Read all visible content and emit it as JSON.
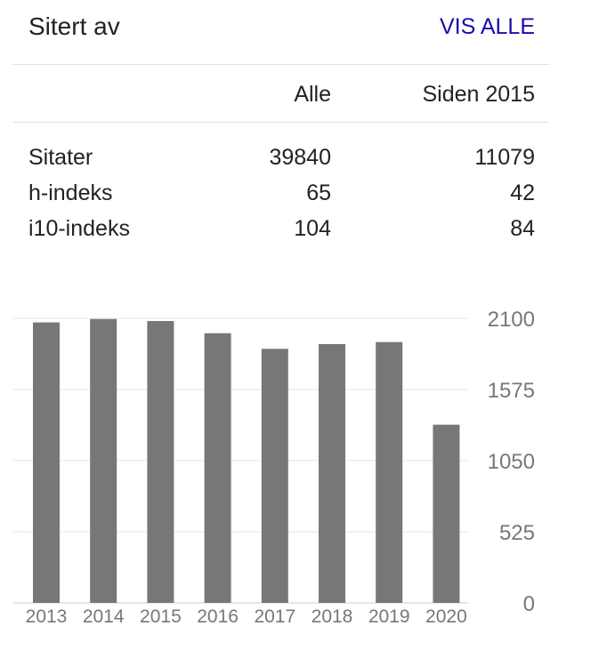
{
  "header": {
    "title": "Sitert av",
    "view_all_label": "VIS ALLE",
    "link_color": "#1a0dab"
  },
  "table": {
    "columns": [
      "Alle",
      "Siden 2015"
    ],
    "rows": [
      {
        "label": "Sitater",
        "all": "39840",
        "since": "11079"
      },
      {
        "label": "h-indeks",
        "all": "65",
        "since": "42"
      },
      {
        "label": "i10-indeks",
        "all": "104",
        "since": "84"
      }
    ]
  },
  "chart_data": {
    "type": "bar",
    "categories": [
      "2013",
      "2014",
      "2015",
      "2016",
      "2017",
      "2018",
      "2019",
      "2020"
    ],
    "values": [
      2070,
      2095,
      2080,
      1990,
      1875,
      1910,
      1925,
      1315
    ],
    "ylim": [
      0,
      2100
    ],
    "yticks": [
      "0",
      "525",
      "1050",
      "1575",
      "2100"
    ],
    "bar_color": "#777777",
    "grid": true
  }
}
